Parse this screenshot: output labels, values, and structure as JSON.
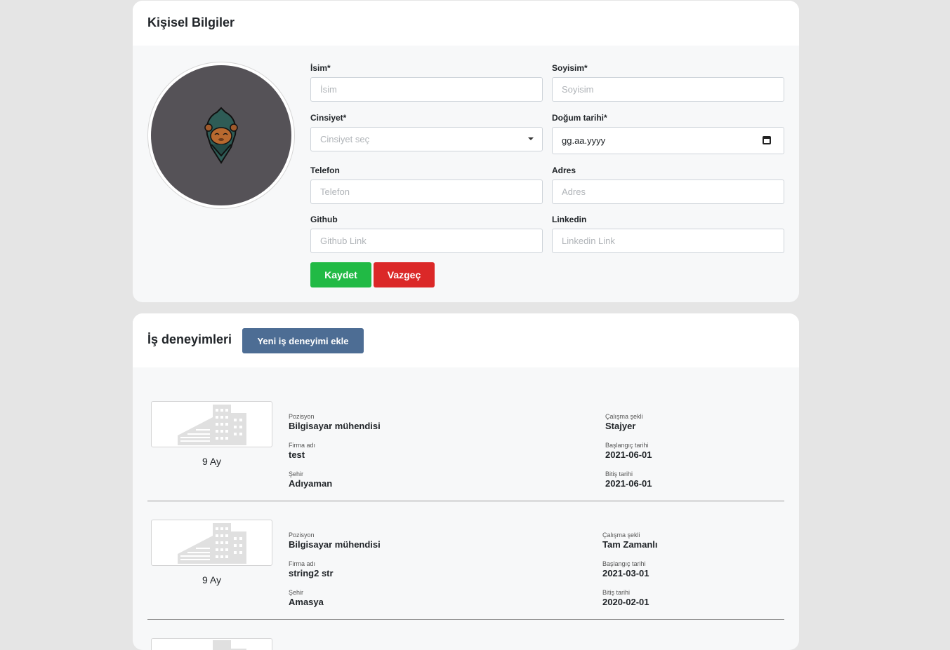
{
  "personal": {
    "title": "Kişisel Bilgiler",
    "fields": {
      "first_name": {
        "label": "İsim*",
        "placeholder": "İsim"
      },
      "last_name": {
        "label": "Soyisim*",
        "placeholder": "Soyisim"
      },
      "gender": {
        "label": "Cinsiyet*",
        "placeholder": "Cinsiyet seç"
      },
      "birth_date": {
        "label": "Doğum tarihi*",
        "value": "gg.aa.yyyy"
      },
      "phone": {
        "label": "Telefon",
        "placeholder": "Telefon"
      },
      "address": {
        "label": "Adres",
        "placeholder": "Adres"
      },
      "github": {
        "label": "Github",
        "placeholder": "Github Link"
      },
      "linkedin": {
        "label": "Linkedin",
        "placeholder": "Linkedin Link"
      }
    },
    "save_label": "Kaydet",
    "cancel_label": "Vazgeç"
  },
  "work": {
    "title": "İş deneyimleri",
    "add_label": "Yeni iş deneyimi ekle",
    "labels": {
      "position": "Pozisyon",
      "company": "Firma adı",
      "city": "Şehir",
      "work_type": "Çalışma şekli",
      "start": "Başlangıç tarihi",
      "end": "Bitiş tarihi"
    },
    "items": [
      {
        "duration": "9 Ay",
        "position": "Bilgisayar mühendisi",
        "company": "test",
        "city": "Adıyaman",
        "work_type": "Stajyer",
        "start": "2021-06-01",
        "end": "2021-06-01"
      },
      {
        "duration": "9 Ay",
        "position": "Bilgisayar mühendisi",
        "company": "string2 str",
        "city": "Amasya",
        "work_type": "Tam Zamanlı",
        "start": "2021-03-01",
        "end": "2020-02-01"
      }
    ]
  },
  "colors": {
    "save": "#21ba45",
    "cancel": "#db2828",
    "add": "#4d6d94",
    "avatar_bg": "#555257"
  }
}
